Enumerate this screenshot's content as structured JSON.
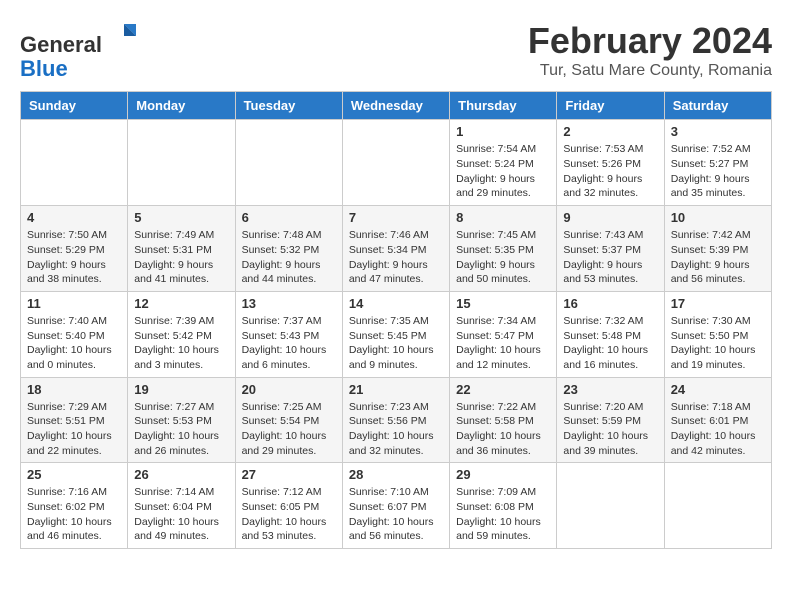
{
  "header": {
    "logo_line1": "General",
    "logo_line2": "Blue",
    "main_title": "February 2024",
    "subtitle": "Tur, Satu Mare County, Romania"
  },
  "calendar": {
    "days_of_week": [
      "Sunday",
      "Monday",
      "Tuesday",
      "Wednesday",
      "Thursday",
      "Friday",
      "Saturday"
    ],
    "weeks": [
      [
        {
          "day": "",
          "info": ""
        },
        {
          "day": "",
          "info": ""
        },
        {
          "day": "",
          "info": ""
        },
        {
          "day": "",
          "info": ""
        },
        {
          "day": "1",
          "info": "Sunrise: 7:54 AM\nSunset: 5:24 PM\nDaylight: 9 hours\nand 29 minutes."
        },
        {
          "day": "2",
          "info": "Sunrise: 7:53 AM\nSunset: 5:26 PM\nDaylight: 9 hours\nand 32 minutes."
        },
        {
          "day": "3",
          "info": "Sunrise: 7:52 AM\nSunset: 5:27 PM\nDaylight: 9 hours\nand 35 minutes."
        }
      ],
      [
        {
          "day": "4",
          "info": "Sunrise: 7:50 AM\nSunset: 5:29 PM\nDaylight: 9 hours\nand 38 minutes."
        },
        {
          "day": "5",
          "info": "Sunrise: 7:49 AM\nSunset: 5:31 PM\nDaylight: 9 hours\nand 41 minutes."
        },
        {
          "day": "6",
          "info": "Sunrise: 7:48 AM\nSunset: 5:32 PM\nDaylight: 9 hours\nand 44 minutes."
        },
        {
          "day": "7",
          "info": "Sunrise: 7:46 AM\nSunset: 5:34 PM\nDaylight: 9 hours\nand 47 minutes."
        },
        {
          "day": "8",
          "info": "Sunrise: 7:45 AM\nSunset: 5:35 PM\nDaylight: 9 hours\nand 50 minutes."
        },
        {
          "day": "9",
          "info": "Sunrise: 7:43 AM\nSunset: 5:37 PM\nDaylight: 9 hours\nand 53 minutes."
        },
        {
          "day": "10",
          "info": "Sunrise: 7:42 AM\nSunset: 5:39 PM\nDaylight: 9 hours\nand 56 minutes."
        }
      ],
      [
        {
          "day": "11",
          "info": "Sunrise: 7:40 AM\nSunset: 5:40 PM\nDaylight: 10 hours\nand 0 minutes."
        },
        {
          "day": "12",
          "info": "Sunrise: 7:39 AM\nSunset: 5:42 PM\nDaylight: 10 hours\nand 3 minutes."
        },
        {
          "day": "13",
          "info": "Sunrise: 7:37 AM\nSunset: 5:43 PM\nDaylight: 10 hours\nand 6 minutes."
        },
        {
          "day": "14",
          "info": "Sunrise: 7:35 AM\nSunset: 5:45 PM\nDaylight: 10 hours\nand 9 minutes."
        },
        {
          "day": "15",
          "info": "Sunrise: 7:34 AM\nSunset: 5:47 PM\nDaylight: 10 hours\nand 12 minutes."
        },
        {
          "day": "16",
          "info": "Sunrise: 7:32 AM\nSunset: 5:48 PM\nDaylight: 10 hours\nand 16 minutes."
        },
        {
          "day": "17",
          "info": "Sunrise: 7:30 AM\nSunset: 5:50 PM\nDaylight: 10 hours\nand 19 minutes."
        }
      ],
      [
        {
          "day": "18",
          "info": "Sunrise: 7:29 AM\nSunset: 5:51 PM\nDaylight: 10 hours\nand 22 minutes."
        },
        {
          "day": "19",
          "info": "Sunrise: 7:27 AM\nSunset: 5:53 PM\nDaylight: 10 hours\nand 26 minutes."
        },
        {
          "day": "20",
          "info": "Sunrise: 7:25 AM\nSunset: 5:54 PM\nDaylight: 10 hours\nand 29 minutes."
        },
        {
          "day": "21",
          "info": "Sunrise: 7:23 AM\nSunset: 5:56 PM\nDaylight: 10 hours\nand 32 minutes."
        },
        {
          "day": "22",
          "info": "Sunrise: 7:22 AM\nSunset: 5:58 PM\nDaylight: 10 hours\nand 36 minutes."
        },
        {
          "day": "23",
          "info": "Sunrise: 7:20 AM\nSunset: 5:59 PM\nDaylight: 10 hours\nand 39 minutes."
        },
        {
          "day": "24",
          "info": "Sunrise: 7:18 AM\nSunset: 6:01 PM\nDaylight: 10 hours\nand 42 minutes."
        }
      ],
      [
        {
          "day": "25",
          "info": "Sunrise: 7:16 AM\nSunset: 6:02 PM\nDaylight: 10 hours\nand 46 minutes."
        },
        {
          "day": "26",
          "info": "Sunrise: 7:14 AM\nSunset: 6:04 PM\nDaylight: 10 hours\nand 49 minutes."
        },
        {
          "day": "27",
          "info": "Sunrise: 7:12 AM\nSunset: 6:05 PM\nDaylight: 10 hours\nand 53 minutes."
        },
        {
          "day": "28",
          "info": "Sunrise: 7:10 AM\nSunset: 6:07 PM\nDaylight: 10 hours\nand 56 minutes."
        },
        {
          "day": "29",
          "info": "Sunrise: 7:09 AM\nSunset: 6:08 PM\nDaylight: 10 hours\nand 59 minutes."
        },
        {
          "day": "",
          "info": ""
        },
        {
          "day": "",
          "info": ""
        }
      ]
    ]
  }
}
